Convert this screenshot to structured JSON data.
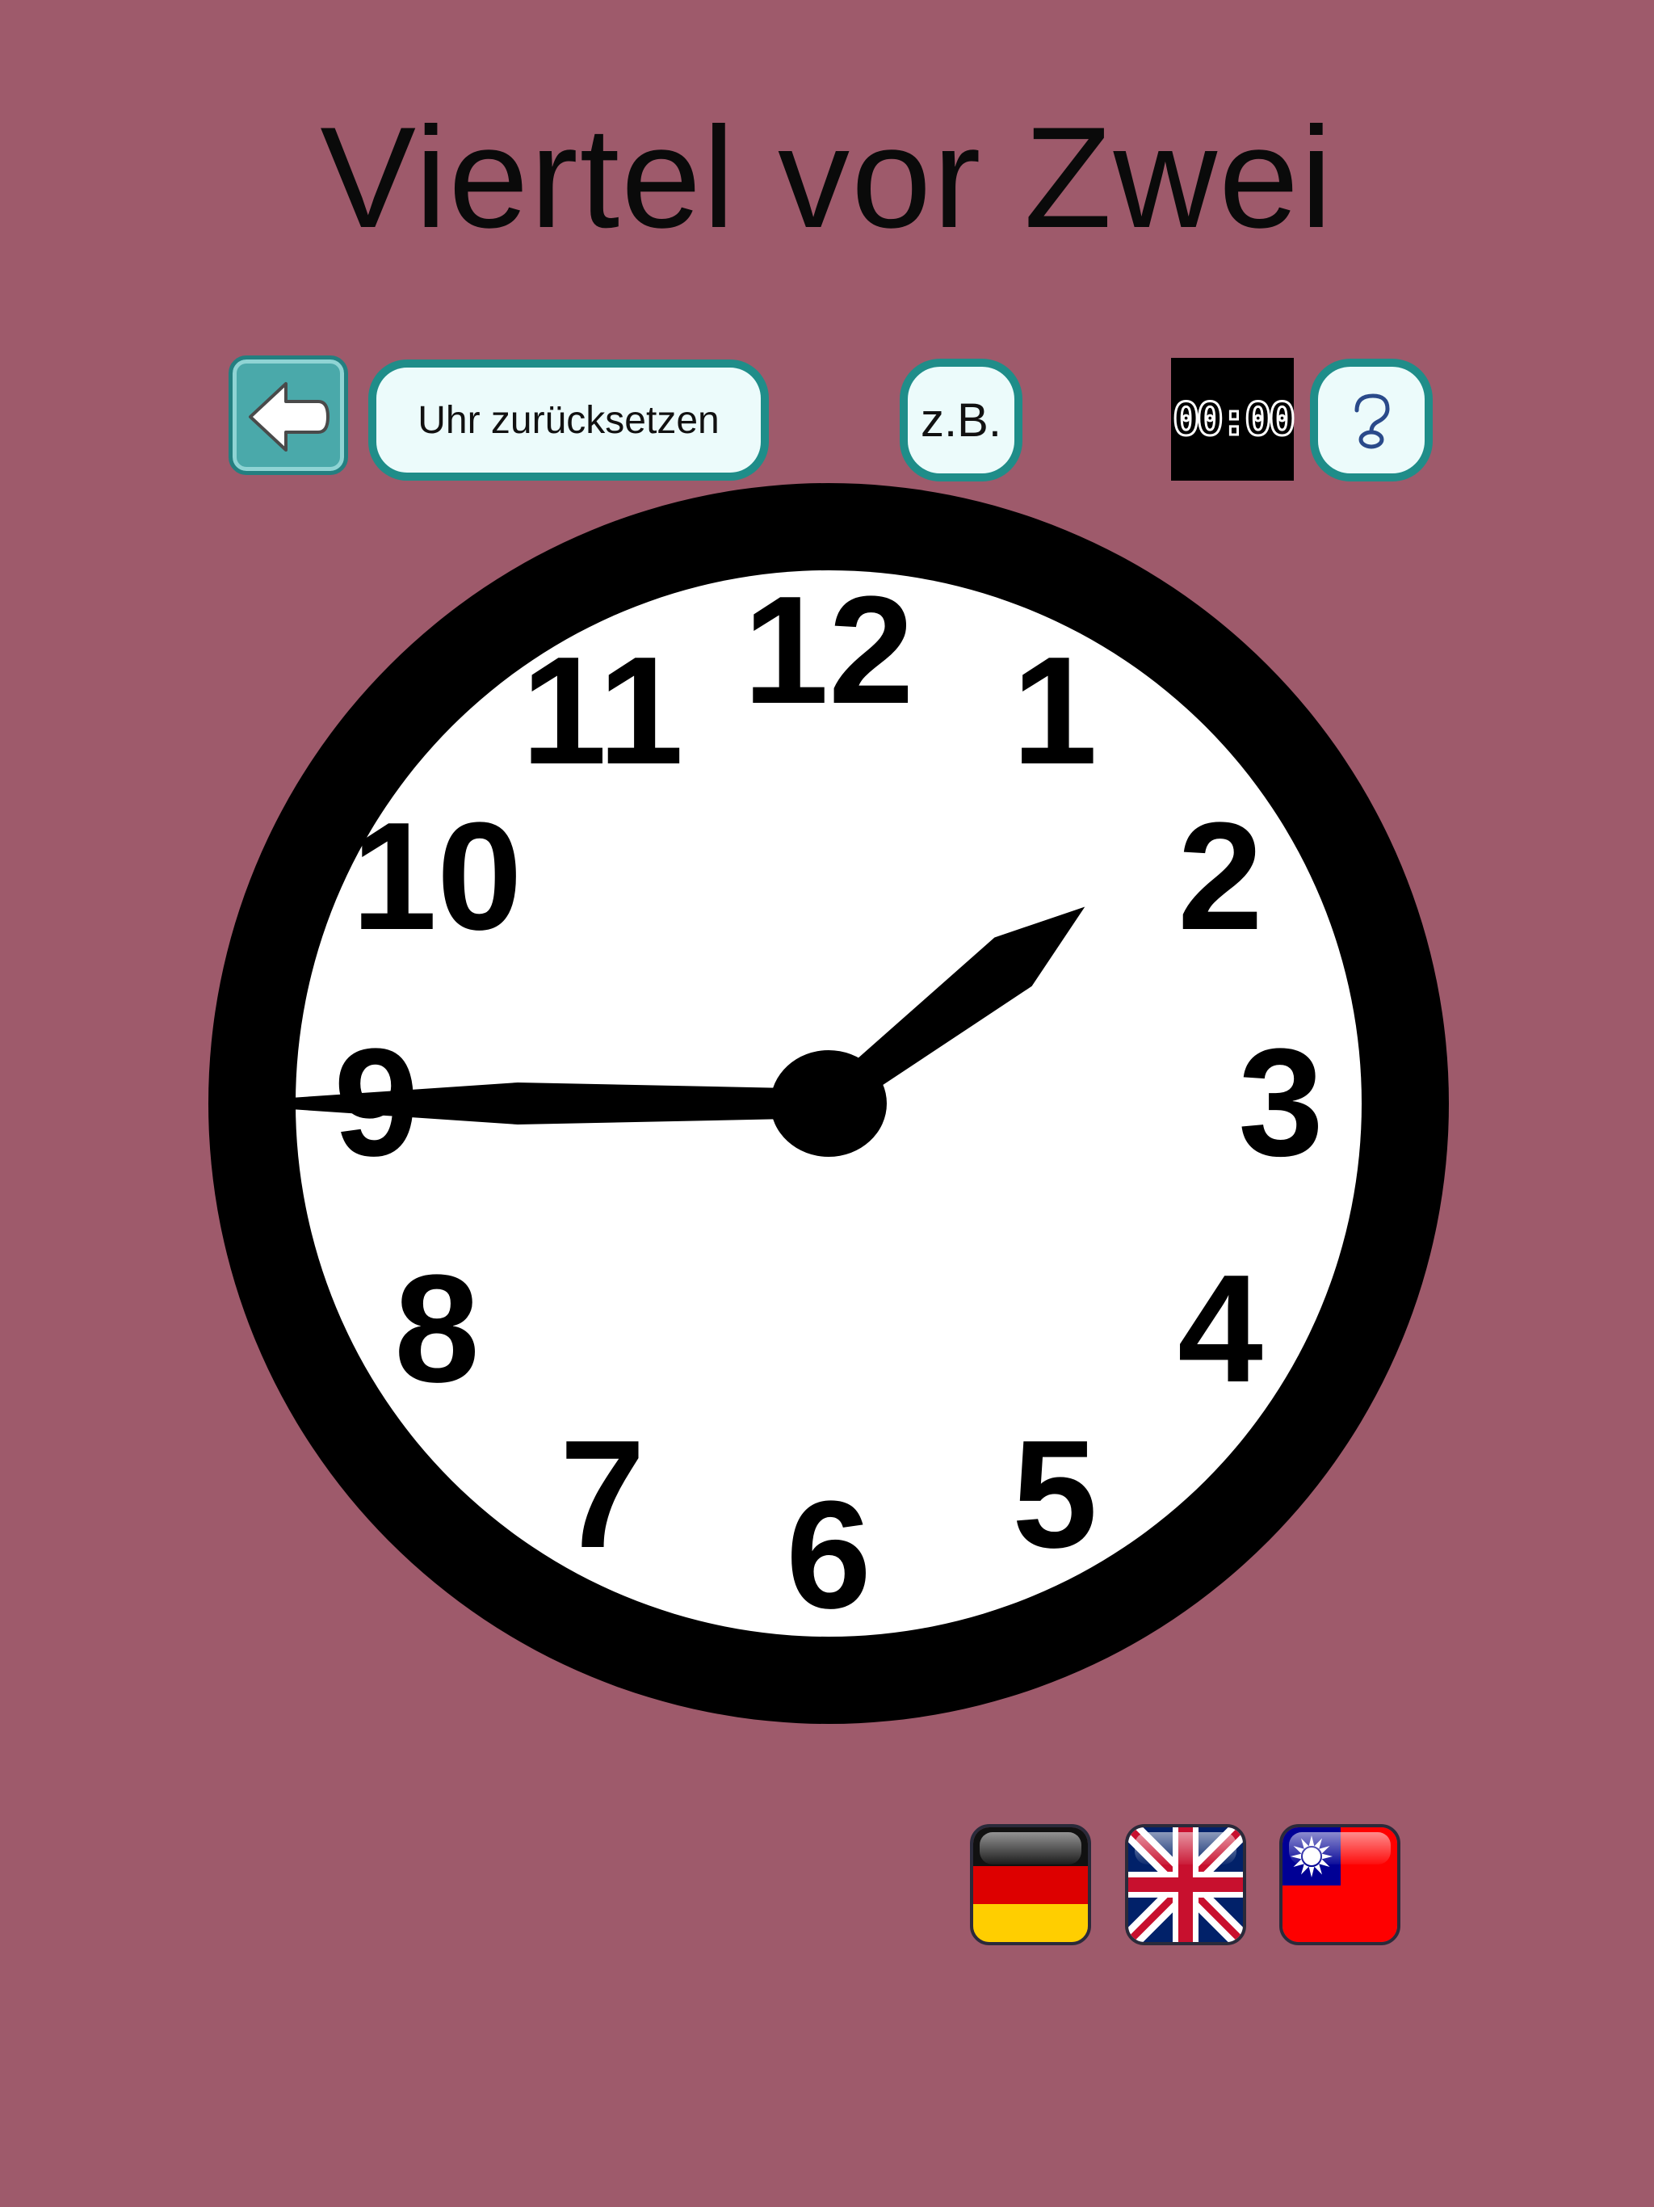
{
  "title": "Viertel vor Zwei",
  "toolbar": {
    "back_icon": "left-arrow-icon",
    "reset_label": "Uhr zurücksetzen",
    "example_label": "z.B.",
    "digital_display": "00:00",
    "help_icon": "question-mark-icon"
  },
  "clock": {
    "numbers": [
      "12",
      "1",
      "2",
      "3",
      "4",
      "5",
      "6",
      "7",
      "8",
      "9",
      "10",
      "11"
    ],
    "hour": 1,
    "minute": 45,
    "face_color": "#ffffff",
    "rim_color": "#000000"
  },
  "languages": [
    {
      "name": "german-flag-icon"
    },
    {
      "name": "uk-flag-icon"
    },
    {
      "name": "taiwan-flag-icon"
    }
  ],
  "colors": {
    "background": "#9e5a6b",
    "button_teal": "#1f8d89",
    "button_fill": "#ecfbfb"
  }
}
